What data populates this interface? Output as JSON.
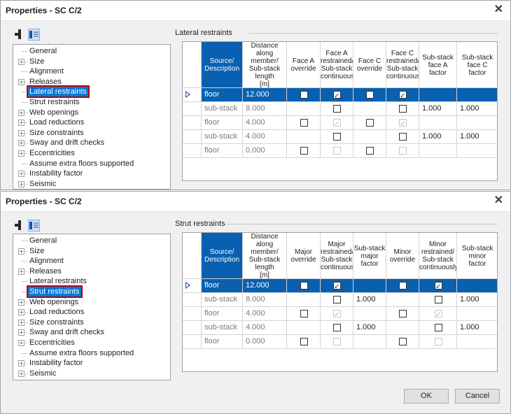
{
  "dialogs": [
    {
      "title": "Properties - SC C/2",
      "section_title": "Lateral restraints",
      "tree": [
        {
          "label": "General",
          "expandable": false
        },
        {
          "label": "Size",
          "expandable": true
        },
        {
          "label": "Alignment",
          "expandable": false
        },
        {
          "label": "Releases",
          "expandable": true
        },
        {
          "label": "Lateral restraints",
          "expandable": false,
          "selected": true
        },
        {
          "label": "Strut restraints",
          "expandable": false
        },
        {
          "label": "Web openings",
          "expandable": true
        },
        {
          "label": "Load reductions",
          "expandable": true
        },
        {
          "label": "Size constraints",
          "expandable": true
        },
        {
          "label": "Sway and drift checks",
          "expandable": true
        },
        {
          "label": "Eccentricities",
          "expandable": true
        },
        {
          "label": "Assume extra floors supported",
          "expandable": false
        },
        {
          "label": "Instability factor",
          "expandable": true
        },
        {
          "label": "Seismic",
          "expandable": true
        }
      ],
      "columns": [
        {
          "lines": []
        },
        {
          "lines": [
            "Source/",
            "Description"
          ]
        },
        {
          "lines": [
            "Distance",
            "along",
            "member/",
            "Sub-stack",
            "length",
            "[m]"
          ]
        },
        {
          "lines": [
            "Face A",
            "override"
          ]
        },
        {
          "lines": [
            "Face A",
            "restrained/",
            "Sub-stack",
            "continuously"
          ]
        },
        {
          "lines": [
            "Face C",
            "override"
          ]
        },
        {
          "lines": [
            "Face C",
            "restrained/",
            "Sub-stack",
            "continuously"
          ]
        },
        {
          "lines": [
            "Sub-stack",
            "face A",
            "factor"
          ]
        },
        {
          "lines": [
            "Sub-stack",
            "face C",
            "factor"
          ]
        }
      ],
      "rows": [
        {
          "selected": true,
          "source": "floor",
          "distance": "12.000",
          "c3": "off",
          "c4": "on",
          "c5": "off",
          "c6": "on",
          "f1": "",
          "f2": ""
        },
        {
          "selected": false,
          "source": "sub-stack",
          "distance": "8.000",
          "c3": "none",
          "c4": "off",
          "c5": "none",
          "c6": "off",
          "f1": "1.000",
          "f2": "1.000"
        },
        {
          "selected": false,
          "source": "floor",
          "distance": "4.000",
          "c3": "off",
          "c4": "dison",
          "c5": "off",
          "c6": "dison",
          "f1": "",
          "f2": ""
        },
        {
          "selected": false,
          "source": "sub-stack",
          "distance": "4.000",
          "c3": "none",
          "c4": "off",
          "c5": "none",
          "c6": "off",
          "f1": "1.000",
          "f2": "1.000"
        },
        {
          "selected": false,
          "source": "floor",
          "distance": "0.000",
          "c3": "off",
          "c4": "disoff",
          "c5": "off",
          "c6": "disoff",
          "f1": "",
          "f2": ""
        }
      ]
    },
    {
      "title": "Properties - SC C/2",
      "section_title": "Strut restraints",
      "tree": [
        {
          "label": "General",
          "expandable": false
        },
        {
          "label": "Size",
          "expandable": true
        },
        {
          "label": "Alignment",
          "expandable": false
        },
        {
          "label": "Releases",
          "expandable": true
        },
        {
          "label": "Lateral restraints",
          "expandable": false
        },
        {
          "label": "Strut restraints",
          "expandable": false,
          "selected": true
        },
        {
          "label": "Web openings",
          "expandable": true
        },
        {
          "label": "Load reductions",
          "expandable": true
        },
        {
          "label": "Size constraints",
          "expandable": true
        },
        {
          "label": "Sway and drift checks",
          "expandable": true
        },
        {
          "label": "Eccentricities",
          "expandable": true
        },
        {
          "label": "Assume extra floors supported",
          "expandable": false
        },
        {
          "label": "Instability factor",
          "expandable": true
        },
        {
          "label": "Seismic",
          "expandable": true
        }
      ],
      "columns": [
        {
          "lines": []
        },
        {
          "lines": [
            "Source/",
            "Description"
          ]
        },
        {
          "lines": [
            "Distance",
            "along",
            "member/",
            "Sub-stack",
            "length",
            "[m]"
          ]
        },
        {
          "lines": [
            "Major",
            "override"
          ]
        },
        {
          "lines": [
            "Major",
            "restrained/",
            "Sub-stack",
            "continuously"
          ]
        },
        {
          "lines": [
            "Sub-stack",
            "major",
            "factor"
          ]
        },
        {
          "lines": [
            "Minor",
            "override"
          ]
        },
        {
          "lines": [
            "Minor",
            "restrained/",
            "Sub-stack",
            "continuously"
          ]
        },
        {
          "lines": [
            "Sub-stack",
            "minor",
            "factor"
          ]
        }
      ],
      "rows": [
        {
          "selected": true,
          "source": "floor",
          "distance": "12.000",
          "c3": "off",
          "c4": "on",
          "f1": "",
          "c6": "off",
          "c7": "on",
          "f2": ""
        },
        {
          "selected": false,
          "source": "sub-stack",
          "distance": "8.000",
          "c3": "none",
          "c4": "off",
          "f1": "1.000",
          "c6": "none",
          "c7": "off",
          "f2": "1.000"
        },
        {
          "selected": false,
          "source": "floor",
          "distance": "4.000",
          "c3": "off",
          "c4": "dison",
          "f1": "",
          "c6": "off",
          "c7": "dison",
          "f2": ""
        },
        {
          "selected": false,
          "source": "sub-stack",
          "distance": "4.000",
          "c3": "none",
          "c4": "off",
          "f1": "1.000",
          "c6": "none",
          "c7": "off",
          "f2": "1.000"
        },
        {
          "selected": false,
          "source": "floor",
          "distance": "0.000",
          "c3": "off",
          "c4": "disoff",
          "f1": "",
          "c6": "off",
          "c7": "disoff",
          "f2": ""
        }
      ]
    }
  ],
  "buttons": {
    "ok": "OK",
    "cancel": "Cancel"
  },
  "icons": {
    "close": "close-icon",
    "toolbar1": "member-icon",
    "toolbar2": "properties-list-icon",
    "expand": "plus-icon",
    "row_pointer": "row-pointer-icon"
  },
  "colors": {
    "selection": "#0a60b0",
    "highlight_outline": "#c00000",
    "dialog_bg": "#f0f0f0"
  }
}
